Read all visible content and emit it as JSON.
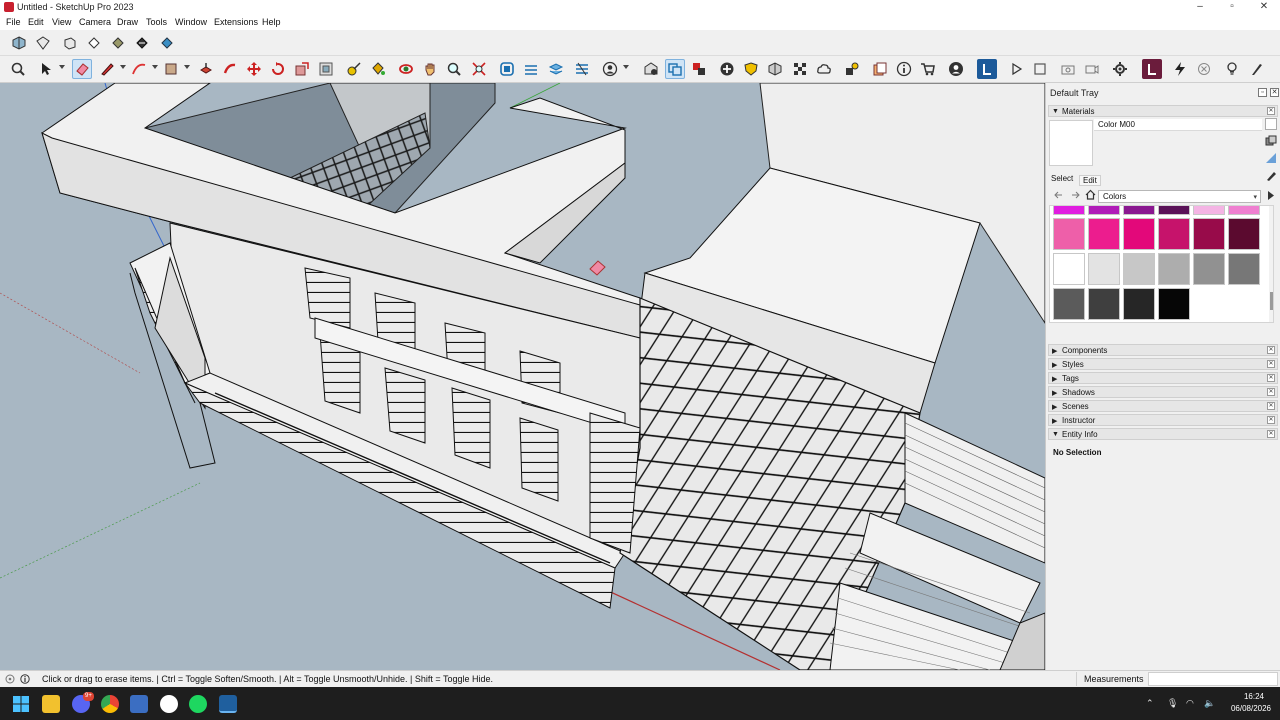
{
  "window": {
    "title": "Untitled - SketchUp Pro 2023",
    "controls": [
      "–",
      "▫",
      "✕"
    ]
  },
  "menu": [
    "File",
    "Edit",
    "View",
    "Camera",
    "Draw",
    "Tools",
    "Window",
    "Extensions",
    "Help"
  ],
  "tray": {
    "title": "Default Tray",
    "materials": {
      "header": "Materials",
      "name": "Color M00",
      "tab_select": "Select",
      "tab_edit": "Edit",
      "library": "Colors",
      "swatches": [
        [
          "#e01ee0",
          "#b01cb8",
          "#8a1890",
          "#5a1258",
          "#f4b4e4",
          "#ef7fd0"
        ],
        [
          "#ee5fa9",
          "#ec1d8e",
          "#e3087a",
          "#c6136b",
          "#980b4a",
          "#5b0a2f"
        ],
        [
          "#ffffff",
          "#e3e3e3",
          "#c7c7c7",
          "#adadad",
          "#919191",
          "#777777"
        ],
        [
          "#5b5b5b",
          "#3f3f3f",
          "#262626",
          "#060606"
        ]
      ]
    },
    "panels": [
      "Components",
      "Styles",
      "Tags",
      "Shadows",
      "Scenes",
      "Instructor",
      "Entity Info"
    ],
    "entity_info": {
      "status": "No Selection"
    }
  },
  "status": {
    "hint": "Click or drag to erase items. | Ctrl = Toggle Soften/Smooth. | Alt = Toggle Unsmooth/Unhide. | Shift = Toggle Hide.",
    "measurements_label": "Measurements"
  },
  "taskbar": {
    "time": "16:24",
    "date": "06/08/2026",
    "badge": "9+"
  }
}
